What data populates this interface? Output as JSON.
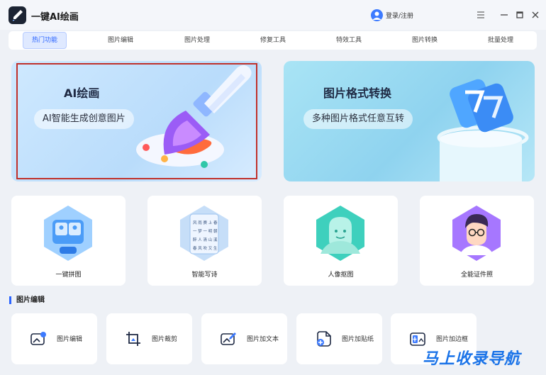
{
  "app": {
    "title": "一键AI绘画",
    "login": "登录/注册"
  },
  "tabs": [
    {
      "label": "热门功能",
      "active": true
    },
    {
      "label": "图片编辑"
    },
    {
      "label": "图片处理"
    },
    {
      "label": "修复工具"
    },
    {
      "label": "特效工具"
    },
    {
      "label": "图片转换"
    },
    {
      "label": "批量处理"
    }
  ],
  "banners": [
    {
      "title": "AI绘画",
      "subtitle": "AI智能生成创意图片"
    },
    {
      "title": "图片格式转换",
      "subtitle": "多种图片格式任意互转"
    }
  ],
  "features": [
    {
      "label": "一键拼图",
      "icon": "collage-icon"
    },
    {
      "label": "智能写诗",
      "icon": "poem-icon"
    },
    {
      "label": "人像抠图",
      "icon": "portrait-cutout-icon"
    },
    {
      "label": "全能证件照",
      "icon": "id-photo-icon"
    }
  ],
  "poem_sample": [
    "风 雨 赛 上 春",
    "一 梦 一 明 朝",
    "醉 人 清 山 溪",
    "春 风 吹 又 生"
  ],
  "section": {
    "title": "图片编辑"
  },
  "tools": [
    {
      "label": "图片编辑",
      "icon": "image-edit-icon"
    },
    {
      "label": "图片裁剪",
      "icon": "crop-icon"
    },
    {
      "label": "图片加文本",
      "icon": "add-text-icon"
    },
    {
      "label": "图片加贴纸",
      "icon": "sticker-icon"
    },
    {
      "label": "图片加边框",
      "icon": "border-icon"
    }
  ],
  "watermark": "马上收录导航",
  "colors": {
    "accent": "#2b64ff",
    "highlight_frame": "#c0302a"
  }
}
